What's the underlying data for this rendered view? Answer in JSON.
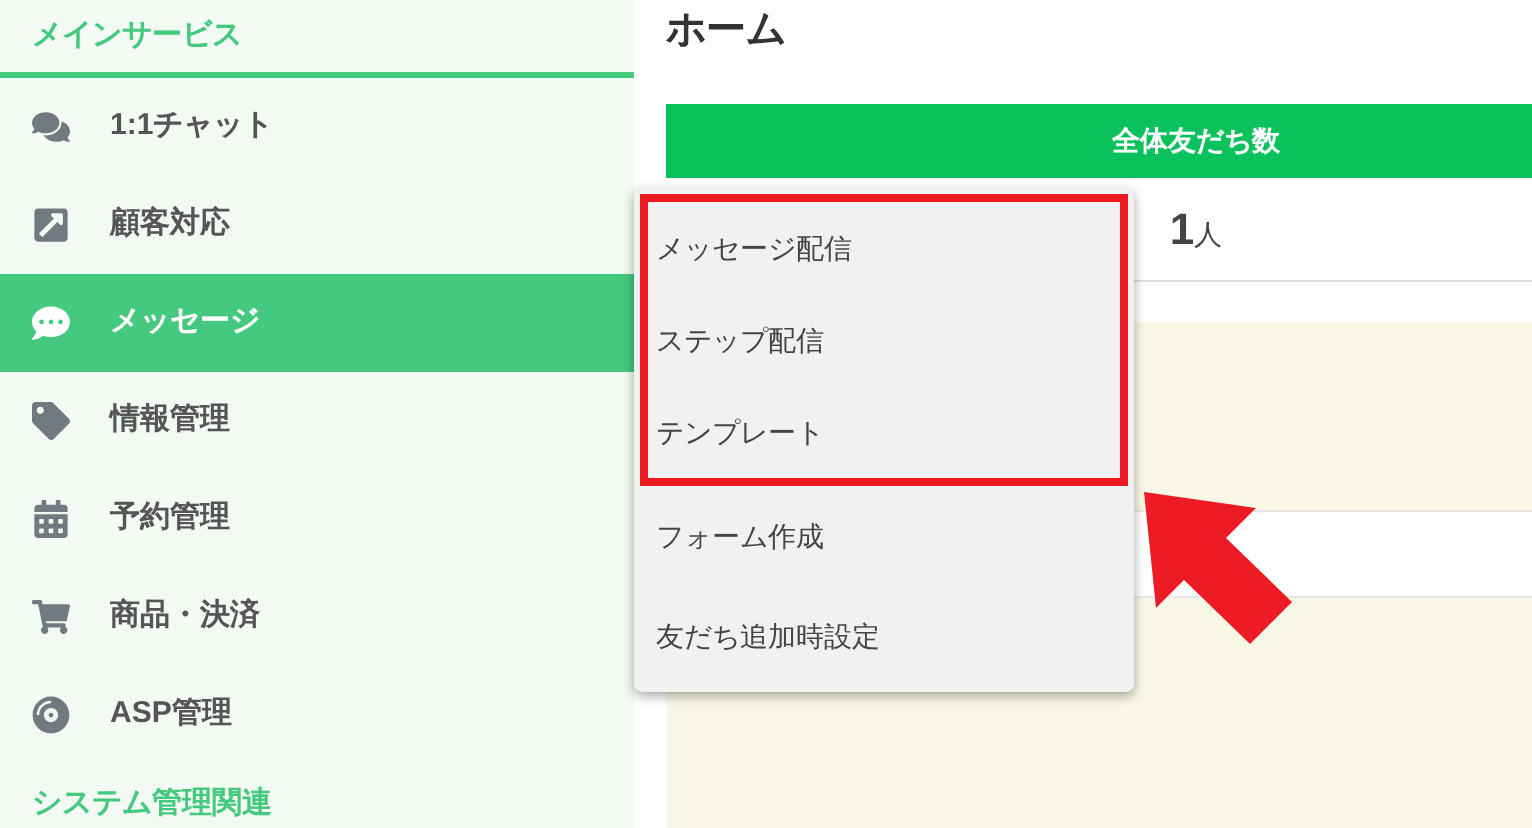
{
  "sidebar": {
    "section_title": "メインサービス",
    "items": [
      {
        "label": "1:1チャット",
        "selected": false
      },
      {
        "label": "顧客対応",
        "selected": false
      },
      {
        "label": "メッセージ",
        "selected": true
      },
      {
        "label": "情報管理",
        "selected": false
      },
      {
        "label": "予約管理",
        "selected": false
      },
      {
        "label": "商品・決済",
        "selected": false
      },
      {
        "label": "ASP管理",
        "selected": false
      }
    ],
    "next_section_title": "システム管理関連"
  },
  "page_title": "ホーム",
  "card": {
    "header": "全体友だち数",
    "count": "1",
    "unit": "人"
  },
  "dropdown": {
    "highlighted_items": [
      "メッセージ配信",
      "ステップ配信",
      "テンプレート"
    ],
    "items": [
      "フォーム作成",
      "友だち追加時設定"
    ]
  }
}
